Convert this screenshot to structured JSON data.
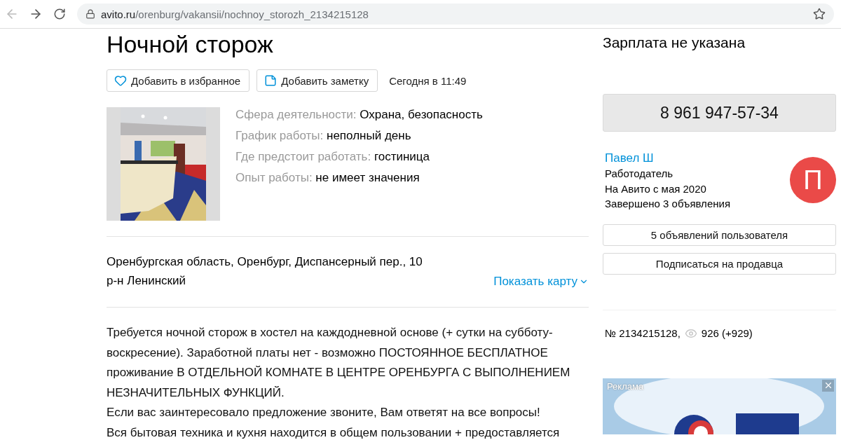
{
  "browser": {
    "url_host": "avito.ru",
    "url_path": "/orenburg/vakansii/nochnoy_storozh_2134215128"
  },
  "listing": {
    "title": "Ночной сторож",
    "actions": [
      {
        "kind": "favorite",
        "label": "Добавить в избранное"
      },
      {
        "kind": "note",
        "label": "Добавить заметку"
      }
    ],
    "posted": "Сегодня в 11:49",
    "params": [
      {
        "label": "Сфера деятельности:",
        "value": "Охрана, безопасность"
      },
      {
        "label": "График работы:",
        "value": "неполный день"
      },
      {
        "label": "Где предстоит работать:",
        "value": "гостиница"
      },
      {
        "label": "Опыт работы:",
        "value": "не имеет значения"
      }
    ],
    "address": {
      "line": "Оренбургская область, Оренбург, Диспансерный пер., 10",
      "district": "р-н Ленинский",
      "map_link": "Показать карту"
    },
    "description": [
      "Требуется ночной сторож в хостел на каждодневной основе (+ сутки на субботу-воскресение). Заработной платы нет - возможно ПОСТОЯННОЕ БЕСПЛАТНОЕ проживание В ОТДЕЛЬНОЙ КОМНАТЕ В ЦЕНТРЕ ОРЕНБУРГА С ВЫПОЛНЕНИЕМ НЕЗНАЧИТЕЛЬНЫХ ФУНКЦИЙ.",
      "Если вас заинтересовало предложение звоните, Вам ответят на все вопросы!",
      "Вся бытовая техника и кухня находится в общем пользовании + предоставляется"
    ]
  },
  "sidebar": {
    "salary": "Зарплата не указана",
    "phone": "8 961 947-57-34",
    "seller": {
      "name": "Павел Ш",
      "role": "Работодатель",
      "since": "На Авито с мая 2020",
      "completed": "Завершено 3 объявления",
      "avatar_letter": "П"
    },
    "buttons": [
      "5 объявлений пользователя",
      "Подписаться на продавца"
    ],
    "item_number": "№ 2134215128,",
    "views": "926 (+929)",
    "ad": {
      "label": "Реклама"
    }
  }
}
